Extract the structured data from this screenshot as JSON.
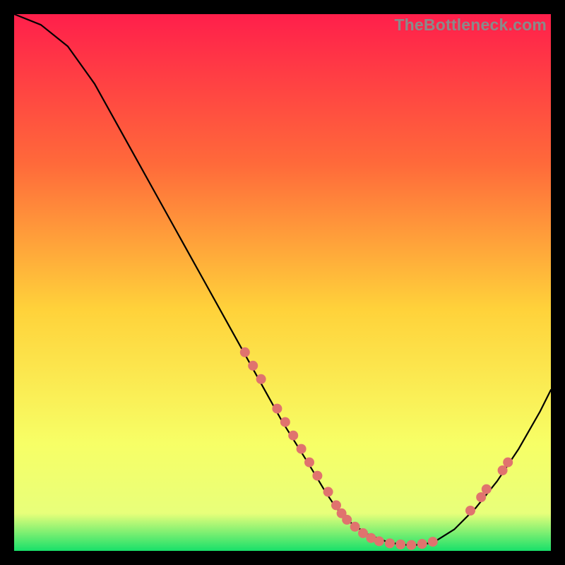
{
  "watermark": "TheBottleneck.com",
  "colors": {
    "gradient_top": "#ff1f4b",
    "gradient_mid_upper": "#ff6a3a",
    "gradient_mid": "#ffd23a",
    "gradient_lower": "#f7ff66",
    "gradient_bottom": "#18e06a",
    "curve": "#000000",
    "dot": "#e0736e",
    "background": "#000000"
  },
  "chart_data": {
    "type": "line",
    "title": "",
    "xlabel": "",
    "ylabel": "",
    "xlim": [
      0,
      100
    ],
    "ylim": [
      0,
      100
    ],
    "series": [
      {
        "name": "bottleneck-curve",
        "x": [
          0,
          5,
          10,
          15,
          20,
          25,
          30,
          35,
          40,
          45,
          50,
          55,
          58,
          60,
          63,
          66,
          70,
          74,
          78,
          82,
          86,
          90,
          94,
          98,
          100
        ],
        "y": [
          100,
          98,
          94,
          87,
          78,
          69,
          60,
          51,
          42,
          33,
          24,
          16,
          11,
          8,
          5,
          3,
          1.5,
          1,
          1.5,
          4,
          8,
          13,
          19,
          26,
          30
        ]
      }
    ],
    "markers": [
      {
        "x": 43,
        "y": 37
      },
      {
        "x": 44.5,
        "y": 34.5
      },
      {
        "x": 46,
        "y": 32
      },
      {
        "x": 49,
        "y": 26.5
      },
      {
        "x": 50.5,
        "y": 24
      },
      {
        "x": 52,
        "y": 21.5
      },
      {
        "x": 53.5,
        "y": 19
      },
      {
        "x": 55,
        "y": 16.5
      },
      {
        "x": 56.5,
        "y": 14
      },
      {
        "x": 58.5,
        "y": 11
      },
      {
        "x": 60,
        "y": 8.5
      },
      {
        "x": 61,
        "y": 7
      },
      {
        "x": 62,
        "y": 5.8
      },
      {
        "x": 63.5,
        "y": 4.5
      },
      {
        "x": 65,
        "y": 3.3
      },
      {
        "x": 66.5,
        "y": 2.4
      },
      {
        "x": 68,
        "y": 1.8
      },
      {
        "x": 70,
        "y": 1.4
      },
      {
        "x": 72,
        "y": 1.2
      },
      {
        "x": 74,
        "y": 1.1
      },
      {
        "x": 76,
        "y": 1.3
      },
      {
        "x": 78,
        "y": 1.7
      },
      {
        "x": 85,
        "y": 7.5
      },
      {
        "x": 87,
        "y": 10
      },
      {
        "x": 88,
        "y": 11.5
      },
      {
        "x": 91,
        "y": 15
      },
      {
        "x": 92,
        "y": 16.5
      }
    ]
  }
}
